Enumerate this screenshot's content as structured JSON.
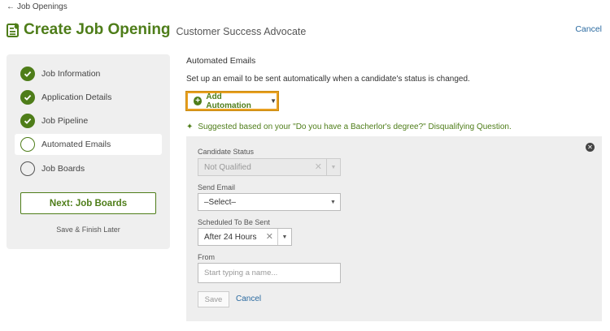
{
  "back_link": {
    "arrow": "←",
    "label": "Job Openings"
  },
  "header": {
    "title": "Create Job Opening",
    "subtitle": "Customer Success Advocate",
    "cancel_label": "Cancel"
  },
  "steps": [
    {
      "label": "Job Information",
      "status": "done"
    },
    {
      "label": "Application Details",
      "status": "done"
    },
    {
      "label": "Job Pipeline",
      "status": "done"
    },
    {
      "label": "Automated Emails",
      "status": "current"
    },
    {
      "label": "Job Boards",
      "status": "todo"
    }
  ],
  "next_button_label": "Next: Job Boards",
  "save_later_label": "Save & Finish Later",
  "section": {
    "title": "Automated Emails",
    "description": "Set up an email to be sent automatically when a candidate's status is changed."
  },
  "add_automation": {
    "icon": "+",
    "label": "Add Automation",
    "caret": "▼"
  },
  "suggestion": {
    "icon": "✦",
    "text": "Suggested based on your \"Do you have a Bacherlor's degree?\" Disqualifying Question."
  },
  "automation": {
    "close_icon": "✕",
    "candidate_status": {
      "label": "Candidate Status",
      "value": "Not Qualified",
      "clear": "✕",
      "caret": "▼"
    },
    "send_email": {
      "label": "Send Email",
      "value": "–Select–",
      "caret": "▼"
    },
    "scheduled": {
      "label": "Scheduled To Be Sent",
      "value": "After 24 Hours",
      "clear": "✕",
      "caret": "▼"
    },
    "from": {
      "label": "From",
      "placeholder": "Start typing a name..."
    },
    "save_label": "Save",
    "cancel_label": "Cancel"
  },
  "colors": {
    "accent": "#4e7d19",
    "link": "#2a6aa0",
    "focus": "#e8a020"
  }
}
